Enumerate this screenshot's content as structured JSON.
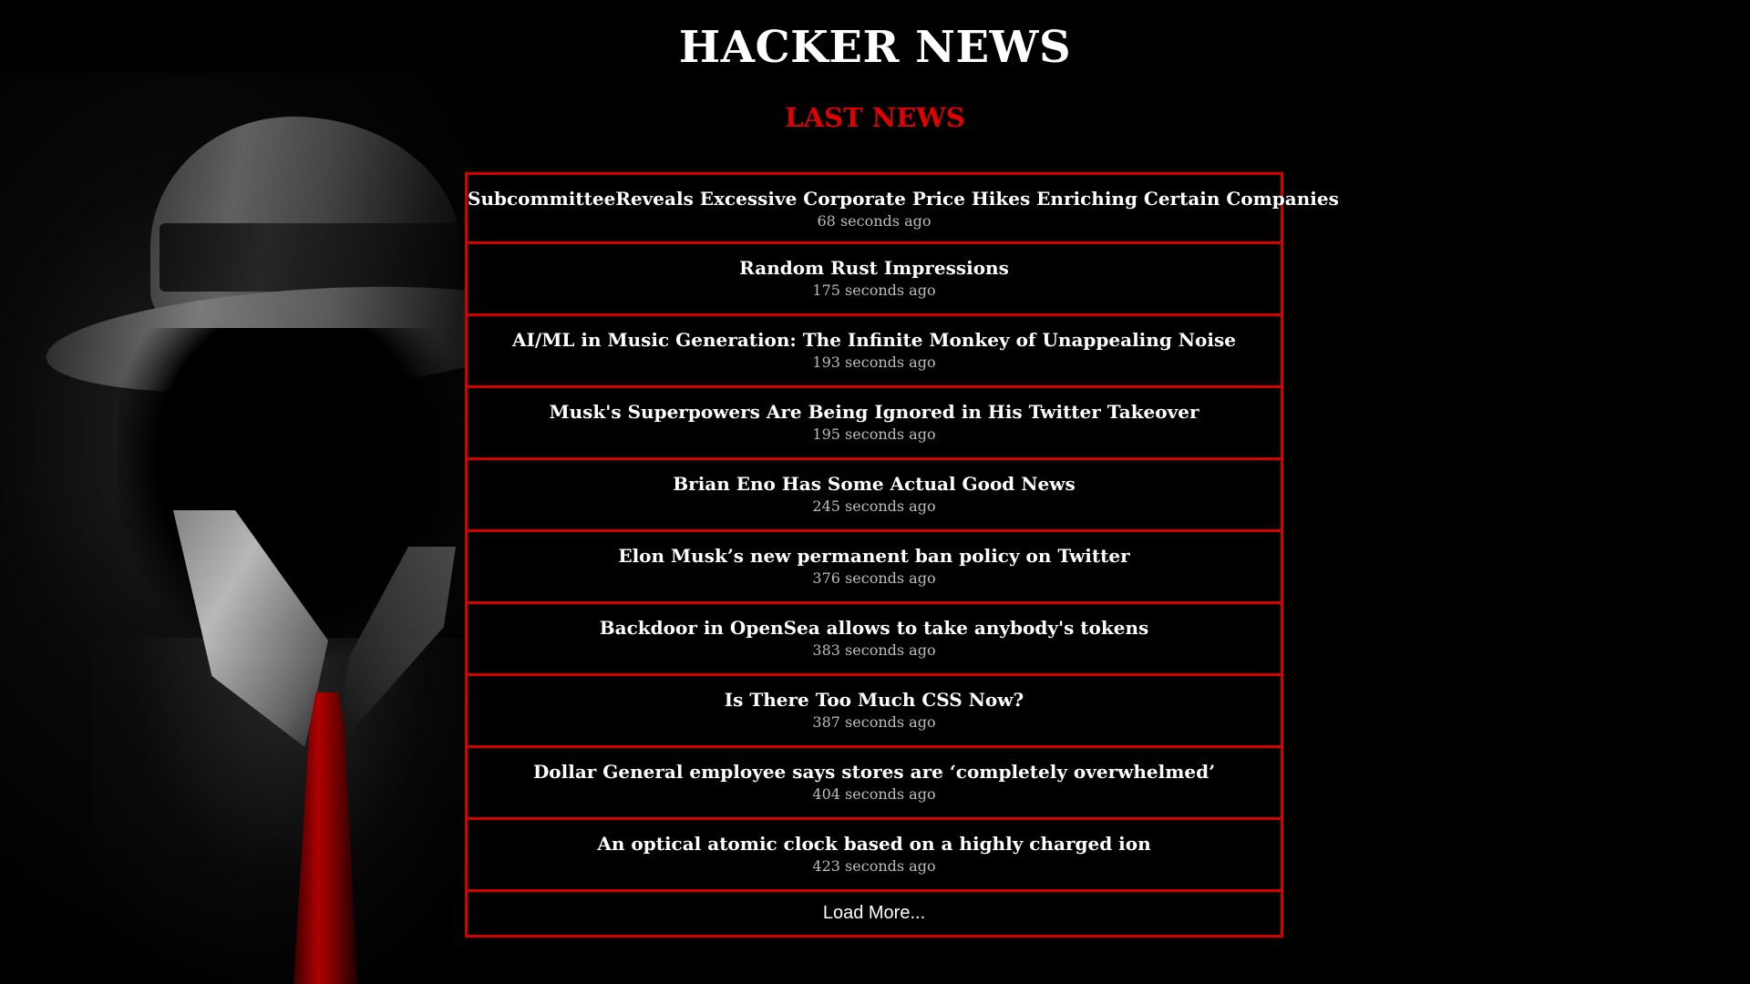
{
  "header": {
    "title": "HACKER NEWS",
    "section_title": "LAST NEWS"
  },
  "colors": {
    "background": "#000000",
    "accent": "#d40000",
    "title": "#ffffff",
    "section_title": "#e00000",
    "time_text": "#bdbdbd"
  },
  "news": [
    {
      "title": "SubcommitteeReveals Excessive Corporate Price Hikes Enriching Certain Companies",
      "time": "68 seconds ago"
    },
    {
      "title": "Random Rust Impressions",
      "time": "175 seconds ago"
    },
    {
      "title": "AI/ML in Music Generation: The Infinite Monkey of Unappealing Noise",
      "time": "193 seconds ago"
    },
    {
      "title": "Musk's Superpowers Are Being Ignored in His Twitter Takeover",
      "time": "195 seconds ago"
    },
    {
      "title": "Brian Eno Has Some Actual Good News",
      "time": "245 seconds ago"
    },
    {
      "title": "Elon Musk’s new permanent ban policy on Twitter",
      "time": "376 seconds ago"
    },
    {
      "title": "Backdoor in OpenSea allows to take anybody's tokens",
      "time": "383 seconds ago"
    },
    {
      "title": "Is There Too Much CSS Now?",
      "time": "387 seconds ago"
    },
    {
      "title": "Dollar General employee says stores are ‘completely overwhelmed’",
      "time": "404 seconds ago"
    },
    {
      "title": "An optical atomic clock based on a highly charged ion",
      "time": "423 seconds ago"
    }
  ],
  "load_more_label": "Load More..."
}
